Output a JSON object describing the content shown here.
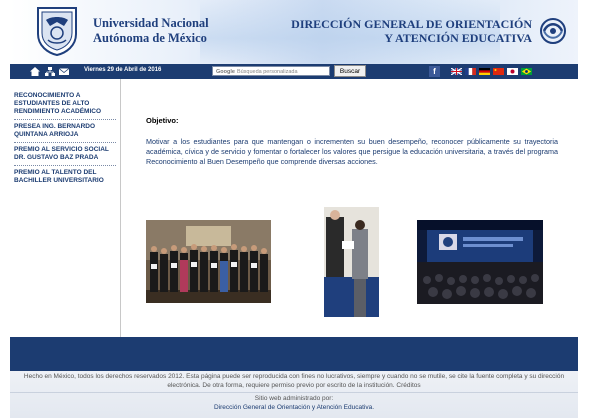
{
  "header": {
    "unam_line1": "Universidad Nacional",
    "unam_line2": "Autónoma de México",
    "dgoae_line1": "DIRECCIÓN GENERAL DE ORIENTACIÓN",
    "dgoae_line2": "Y ATENCIÓN EDUCATIVA"
  },
  "navbar": {
    "date": "Viernes 29 de Abril de 2016",
    "search_brand": "Google",
    "search_placeholder": "Búsqueda personalizada",
    "search_button": "Buscar",
    "icons": [
      "home-icon",
      "sitemap-icon",
      "mail-icon"
    ],
    "flags": [
      "uk-flag",
      "france-flag",
      "germany-flag",
      "china-flag",
      "japan-flag",
      "brazil-flag"
    ]
  },
  "sidebar": {
    "items": [
      {
        "label": "RECONOCIMIENTO A ESTUDIANTES DE ALTO RENDIMIENTO ACADÉMICO"
      },
      {
        "label": "PRESEA ING. BERNARDO QUINTANA ARRIOJA"
      },
      {
        "label": "PREMIO AL SERVICIO SOCIAL DR. GUSTAVO BAZ PRADA"
      },
      {
        "label": "PREMIO AL TALENTO DEL BACHILLER UNIVERSITARIO"
      }
    ]
  },
  "main": {
    "objective_title": "Objetivo:",
    "objective_text": "Motivar a los estudiantes para que mantengan o incrementen su buen desempeño, reconocer públicamente su trayectoria académica, cívica y de servicio y fomentar o fortalecer los valores que persigue la educación universitaria, a través del programa Reconocimiento al Buen Desempeño que comprende diversas acciones."
  },
  "footer": {
    "rights": "Hecho en México, todos los derechos reservados 2012. Esta página puede ser reproducida con fines no lucrativos, siempre y cuando no se mutile, se cite la fuente completa y su dirección electrónica. De otra forma, requiere permiso previo por escrito de la institución. Créditos",
    "admin_label": "Sitio web administrado por:",
    "admin_name": "Dirección General de Orientación y Atención Educativa."
  },
  "colors": {
    "navy": "#1c3c71",
    "brand_text": "#1f3f7d"
  }
}
